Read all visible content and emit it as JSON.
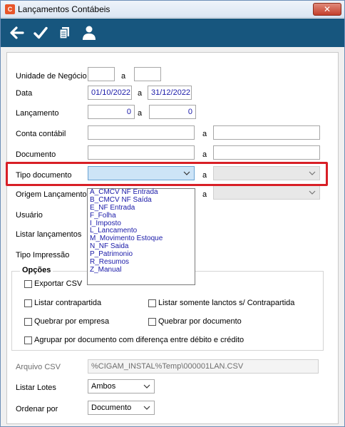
{
  "window": {
    "title": "Lançamentos Contábeis",
    "close": "✕"
  },
  "toolbar": {
    "icons": [
      "back-arrow-icon",
      "check-icon",
      "copy-icon",
      "user-icon"
    ]
  },
  "form": {
    "unidade_label": "Unidade de Negócio",
    "unidade_from": "",
    "unidade_sep": "a",
    "unidade_to": "",
    "data_label": "Data",
    "data_from": "01/10/2022",
    "data_sep": "a",
    "data_to": "31/12/2022",
    "lancamento_label": "Lançamento",
    "lancamento_from": "0",
    "lancamento_sep": "a",
    "lancamento_to": "0",
    "conta_label": "Conta contábil",
    "conta_from": "",
    "conta_sep": "a",
    "conta_to": "",
    "documento_label": "Documento",
    "documento_from": "",
    "documento_sep": "a",
    "documento_to": "",
    "tipo_label": "Tipo documento",
    "tipo_sep": "a",
    "origem_label": "Origem Lançamento",
    "origem_sep": "a",
    "usuario_label": "Usuário",
    "listar_lanc_label": "Listar lançamentos",
    "tipo_impressao_label": "Tipo Impressão"
  },
  "dropdown_options": [
    "A_CMCV NF Entrada",
    "B_CMCV NF Saída",
    "E_NF Entrada",
    "F_Folha",
    "I_Imposto",
    "L_Lancamento",
    "M_Movimento Estoque",
    "N_NF Saida",
    "P_Patrimonio",
    "R_Resumos",
    "Z_Manual"
  ],
  "opcoes": {
    "title": "Opções",
    "exportar_csv": "Exportar CSV",
    "listar_contrapartida": "Listar contrapartida",
    "listar_somente": "Listar somente lanctos s/ Contrapartida",
    "quebrar_empresa": "Quebrar por empresa",
    "quebrar_documento": "Quebrar por documento",
    "agrupar": "Agrupar por documento com diferença entre débito e crédito"
  },
  "bottom": {
    "arquivo_label": "Arquivo CSV",
    "arquivo_value": "%CIGAM_INSTAL%Temp\\000001LAN.CSV",
    "listar_lotes_label": "Listar Lotes",
    "listar_lotes_value": "Ambos",
    "ordenar_label": "Ordenar por",
    "ordenar_value": "Documento"
  },
  "colors": {
    "toolbar": "#17567e",
    "highlight": "#d81f26",
    "input_text": "#1a1aa8"
  }
}
